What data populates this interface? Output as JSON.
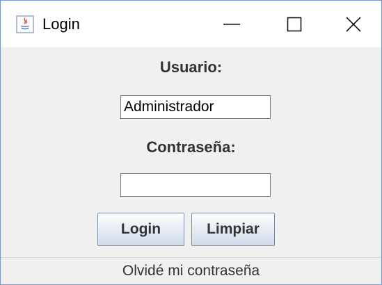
{
  "window": {
    "title": "Login",
    "icon": "java-icon"
  },
  "form": {
    "user_label": "Usuario:",
    "user_value": "Administrador",
    "password_label": "Contraseña:",
    "password_value": ""
  },
  "buttons": {
    "login_label": "Login",
    "clear_label": "Limpiar"
  },
  "footer": {
    "forgot_label": "Olvidé mi contraseña"
  },
  "colors": {
    "window_border": "#7a98c8",
    "background": "#f0f0f0",
    "label_text": "#333333"
  }
}
